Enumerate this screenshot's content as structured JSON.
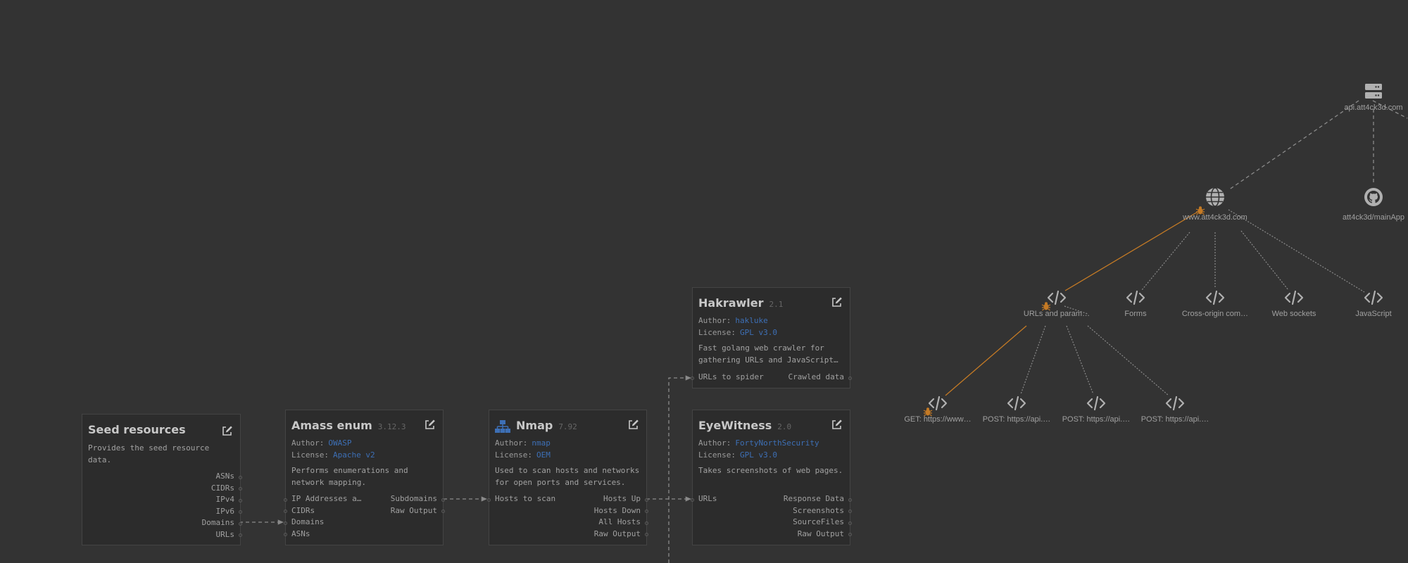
{
  "colors": {
    "background": "#333333",
    "card": "#2c2c2c",
    "link": "#3d6fb5",
    "finding": "#c47a25",
    "edge": "#8a8a8a"
  },
  "cards": {
    "seed": {
      "title": "Seed resources",
      "description": "Provides the seed resource data.",
      "outputs": [
        "ASNs",
        "CIDRs",
        "IPv4",
        "IPv6",
        "Domains",
        "URLs"
      ]
    },
    "amass": {
      "title": "Amass enum",
      "version": "3.12.3",
      "author_label": "Author:",
      "author": "OWASP",
      "license_label": "License:",
      "license": "Apache v2",
      "description": "Performs enumerations and network mapping.",
      "inputs": [
        "IP Addresses a…",
        "CIDRs",
        "Domains",
        "ASNs"
      ],
      "outputs": [
        "Subdomains",
        "Raw Output"
      ]
    },
    "nmap": {
      "title": "Nmap",
      "version": "7.92",
      "author_label": "Author:",
      "author": "nmap",
      "license_label": "License:",
      "license": "OEM",
      "description": "Used to scan hosts and networks for open ports and services.",
      "inputs": [
        "Hosts to scan"
      ],
      "outputs": [
        "Hosts Up",
        "Hosts Down",
        "All Hosts",
        "Raw Output"
      ]
    },
    "hakrawler": {
      "title": "Hakrawler",
      "version": "2.1",
      "author_label": "Author:",
      "author": "hakluke",
      "license_label": "License:",
      "license": "GPL v3.0",
      "description": "Fast golang web crawler for gathering URLs and JavaScript…",
      "inputs": [
        "URLs to spider"
      ],
      "outputs": [
        "Crawled data"
      ]
    },
    "eyewitness": {
      "title": "EyeWitness",
      "version": "2.0",
      "author_label": "Author:",
      "author": "FortyNorthSecurity",
      "license_label": "License:",
      "license": "GPL v3.0",
      "description": "Takes screenshots of web pages.",
      "inputs": [
        "URLs"
      ],
      "outputs": [
        "Response Data",
        "Screenshots",
        "SourceFiles",
        "Raw Output"
      ]
    }
  },
  "graph": {
    "api_server": {
      "label": "api.att4ck3d.com",
      "icon": "server-icon"
    },
    "github": {
      "label": "att4ck3d/mainApp",
      "icon": "github-icon"
    },
    "website": {
      "label": "www.att4ck3d.com",
      "icon": "globe-icon",
      "finding": true
    },
    "categories": [
      {
        "label": "URLs and param…",
        "icon": "code-icon",
        "finding": true
      },
      {
        "label": "Forms",
        "icon": "code-icon"
      },
      {
        "label": "Cross-origin com…",
        "icon": "code-icon"
      },
      {
        "label": "Web sockets",
        "icon": "code-icon"
      },
      {
        "label": "JavaScript",
        "icon": "code-icon"
      }
    ],
    "requests": [
      {
        "label": "GET: https://www…",
        "icon": "code-icon",
        "finding": true
      },
      {
        "label": "POST: https://api.…",
        "icon": "code-icon"
      },
      {
        "label": "POST: https://api.…",
        "icon": "code-icon"
      },
      {
        "label": "POST: https://api.…",
        "icon": "code-icon"
      }
    ]
  }
}
